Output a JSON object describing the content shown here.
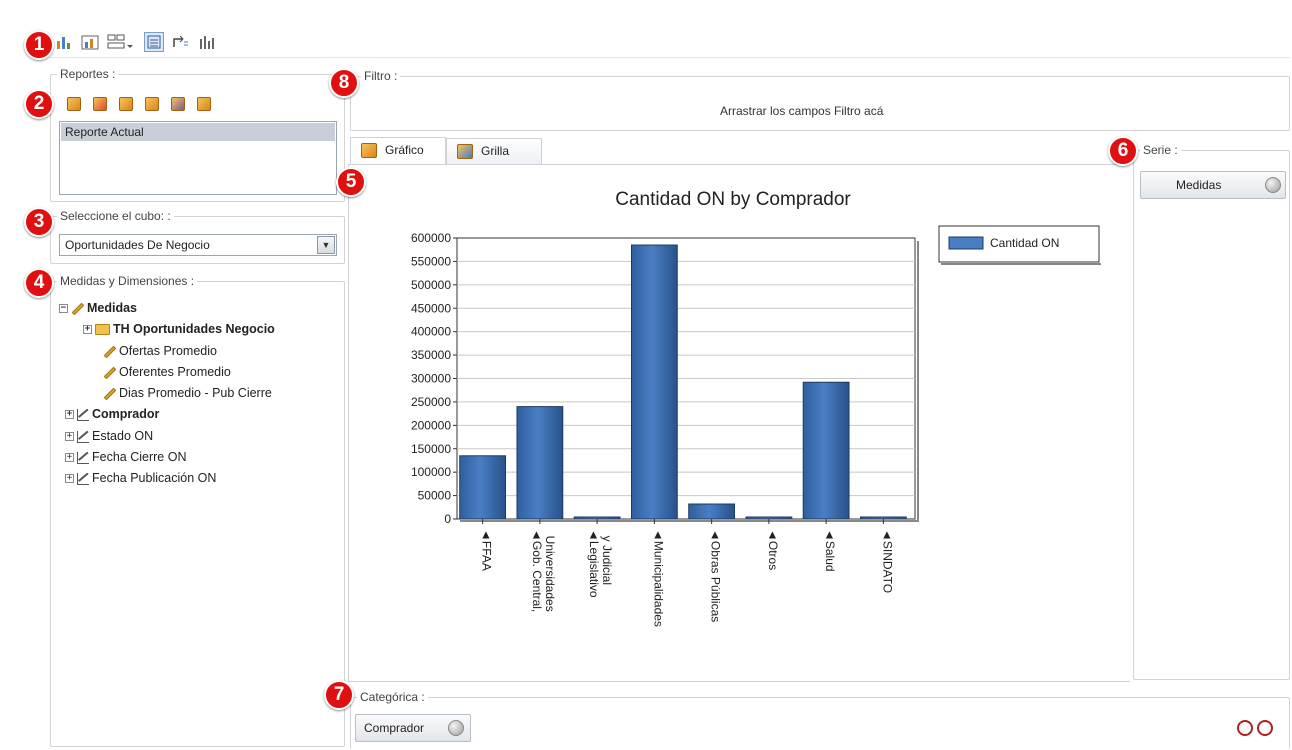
{
  "badges": [
    "1",
    "2",
    "3",
    "4",
    "5",
    "6",
    "7",
    "8"
  ],
  "toolbar": {
    "icons": [
      "chart-icon",
      "chart-alt-icon",
      "layout-icon",
      "list-icon",
      "swap-icon",
      "grid-chart-icon"
    ]
  },
  "reportes": {
    "label": "Reportes :",
    "icons": [
      "new-report-icon",
      "delete-report-icon",
      "open-report-icon",
      "import-report-icon",
      "save-report-icon",
      "export-report-icon"
    ],
    "items": [
      "Reporte Actual"
    ]
  },
  "cubo": {
    "label": "Seleccione el cubo: :",
    "value": "Oportunidades De Negocio"
  },
  "medidas": {
    "label": "Medidas y Dimensiones :",
    "tree": {
      "root": "Medidas",
      "folder": "TH Oportunidades Negocio",
      "measures": [
        "Ofertas Promedio",
        "Oferentes Promedio",
        "Dias Promedio - Pub Cierre"
      ],
      "dimensions": [
        "Comprador",
        "Estado ON",
        "Fecha Cierre ON",
        "Fecha Publicación ON"
      ]
    }
  },
  "filtro": {
    "label": "Filtro :",
    "placeholder": "Arrastrar los campos Filtro acá"
  },
  "tabs": [
    "Gráfico",
    "Grilla"
  ],
  "serie": {
    "label": "Serie :",
    "button": "Medidas"
  },
  "categorica": {
    "label": "Categórica :",
    "button": "Comprador"
  },
  "colors": {
    "bar": "#4a7ec4",
    "badge": "#e01010"
  },
  "chart_data": {
    "type": "bar",
    "title": "Cantidad ON by Comprador",
    "categories": [
      "FFAA",
      "Gob. Central, Universidades",
      "Legislativo y Judicial",
      "Municipalidades",
      "Obras Públicas",
      "Otros",
      "Salud",
      "SINDATO"
    ],
    "category_lines": [
      [
        "FFAA"
      ],
      [
        "Gob. Central,",
        "Universidades"
      ],
      [
        "Legislativo",
        "y Judicial"
      ],
      [
        "Municipalidades"
      ],
      [
        "Obras Públicas"
      ],
      [
        "Otros"
      ],
      [
        "Salud"
      ],
      [
        "SINDATO"
      ]
    ],
    "series": [
      {
        "name": "Cantidad ON",
        "values": [
          135000,
          240000,
          2000,
          585000,
          32000,
          2000,
          292000,
          2000
        ]
      }
    ],
    "yticks": [
      "0",
      "50000",
      "100000",
      "150000",
      "200000",
      "250000",
      "300000",
      "350000",
      "400000",
      "450000",
      "500000",
      "550000",
      "600000"
    ],
    "ylim": [
      0,
      600000
    ],
    "grid": true,
    "legend": "top-right"
  }
}
